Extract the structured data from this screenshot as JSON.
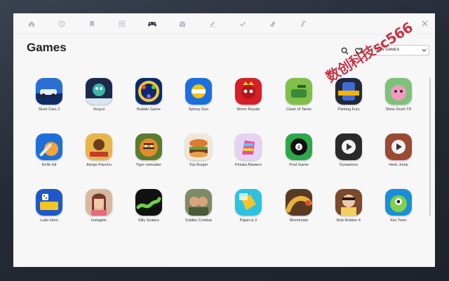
{
  "page": {
    "title": "Games"
  },
  "filter": {
    "selected": "NEW GAMES"
  },
  "watermark": "数创科技sc566",
  "nav_icons": [
    "home-icon",
    "history-icon",
    "bookmark-icon",
    "apps-icon",
    "gamepad-icon",
    "mail-icon",
    "edit-icon",
    "check-icon",
    "weather-icon",
    "music-icon"
  ],
  "games": [
    {
      "name": "Stunt Cars 2",
      "color": "#2a6fd1",
      "color2": "#0f2c66"
    },
    {
      "name": "Vorg.io",
      "color": "#1b2a4a",
      "color2": "#d8e4ef"
    },
    {
      "name": "Bubble Game",
      "color": "#0b2b6e",
      "color2": "#f5c431"
    },
    {
      "name": "Spinny Gun",
      "color": "#1c6fe0",
      "color2": "#f0c419"
    },
    {
      "name": "Worm Royale",
      "color": "#d61f27",
      "color2": "#ffd11a"
    },
    {
      "name": "Clash of Tanks",
      "color": "#7fbf4a",
      "color2": "#3b8a3a"
    },
    {
      "name": "Parking Fury",
      "color": "#222a3a",
      "color2": "#f4b400"
    },
    {
      "name": "Slime Rush TD",
      "color": "#7ec27a",
      "color2": "#f49ac1"
    },
    {
      "name": "Knife Hit",
      "color": "#1f6fd8",
      "color2": "#f3a43a"
    },
    {
      "name": "Amigo Pancho",
      "color": "#e7b64a",
      "color2": "#6b3e1e"
    },
    {
      "name": "Tiger simulator",
      "color": "#5b7b2f",
      "color2": "#e38b2a"
    },
    {
      "name": "Top Burger",
      "color": "#f0e7d8",
      "color2": "#e07a2c"
    },
    {
      "name": "Piniata Masters",
      "color": "#e6d2f2",
      "color2": "#e94f9c"
    },
    {
      "name": "Pool Game",
      "color": "#2ca84a",
      "color2": "#111111"
    },
    {
      "name": "Dynamons",
      "color": "#2a2a2a",
      "color2": "#f1f1f1"
    },
    {
      "name": "Helix Jump",
      "color": "#9a4a34",
      "color2": "#f1f1f1"
    },
    {
      "name": "Ludo Hero",
      "color": "#1e58c8",
      "color2": "#f5c51f"
    },
    {
      "name": "Instagirls",
      "color": "#d8b89e",
      "color2": "#7a3a2a"
    },
    {
      "name": "Silly Snakes",
      "color": "#111111",
      "color2": "#6cd14a"
    },
    {
      "name": "Soldier Combat",
      "color": "#7e8a66",
      "color2": "#d8a47c"
    },
    {
      "name": "Paper.io 2",
      "color": "#2bc3df",
      "color2": "#f4c22b"
    },
    {
      "name": "Wormmate",
      "color": "#5a3b22",
      "color2": "#e9b23a"
    },
    {
      "name": "Bob Robber 4",
      "color": "#7a4a2a",
      "color2": "#f2d060"
    },
    {
      "name": "Kizi Town",
      "color": "#1a8fd6",
      "color2": "#7fd04a"
    }
  ]
}
